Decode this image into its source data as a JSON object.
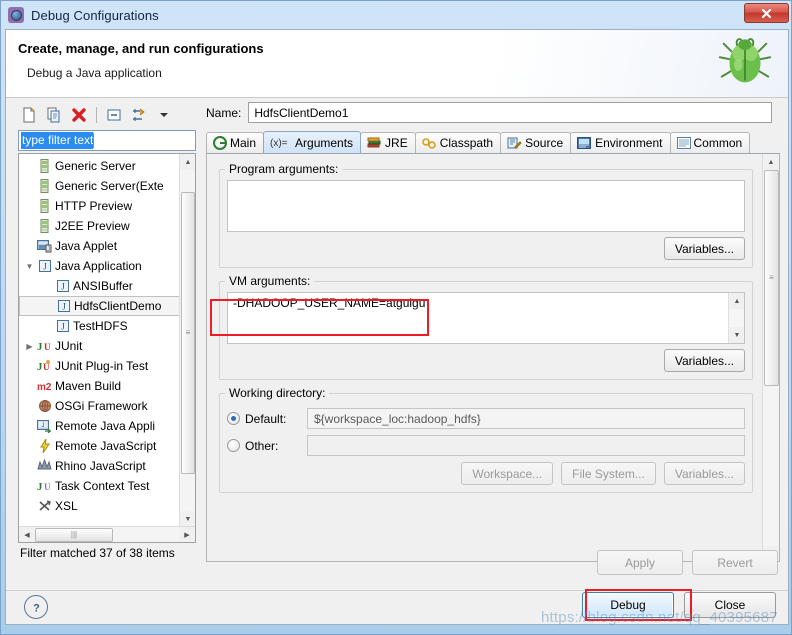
{
  "window": {
    "title": "Debug Configurations",
    "title_icon": "debug-config-icon",
    "close_label": "x"
  },
  "header": {
    "title": "Create, manage, and run configurations",
    "subtitle": "Debug a Java application",
    "icon": "green-bug-icon"
  },
  "tree_toolbar": {
    "items": [
      {
        "name": "new-launch-configuration",
        "icon": "new-document-icon"
      },
      {
        "name": "duplicate-configuration",
        "icon": "copy-icon"
      },
      {
        "name": "delete-configuration",
        "icon": "red-x-delete-icon"
      },
      {
        "name": "collapse-all",
        "icon": "collapse-all-icon"
      },
      {
        "name": "filter-configurations",
        "icon": "filter-arrows-icon"
      },
      {
        "name": "view-menu",
        "icon": "chevron-down-icon"
      }
    ]
  },
  "filter": {
    "value": "type filter text",
    "placeholder": "type filter text",
    "status": "Filter matched 37 of 38 items"
  },
  "tree": {
    "items": [
      {
        "label": "Generic Server",
        "icon": "server-icon",
        "indent": 1,
        "twisty": "",
        "selected": false
      },
      {
        "label": "Generic Server(Exte",
        "icon": "server-icon",
        "indent": 1,
        "twisty": "",
        "selected": false
      },
      {
        "label": "HTTP Preview",
        "icon": "server-icon",
        "indent": 1,
        "twisty": "",
        "selected": false
      },
      {
        "label": "J2EE Preview",
        "icon": "server-icon",
        "indent": 1,
        "twisty": "",
        "selected": false
      },
      {
        "label": "Java Applet",
        "icon": "java-applet-icon",
        "indent": 1,
        "twisty": "",
        "selected": false
      },
      {
        "label": "Java Application",
        "icon": "java-application-icon",
        "indent": 1,
        "twisty": "▼",
        "selected": false
      },
      {
        "label": "ANSIBuffer",
        "icon": "java-launch-icon",
        "indent": 2,
        "twisty": "",
        "selected": false
      },
      {
        "label": "HdfsClientDemo",
        "icon": "java-launch-icon",
        "indent": 2,
        "twisty": "",
        "selected": true
      },
      {
        "label": "TestHDFS",
        "icon": "java-launch-icon",
        "indent": 2,
        "twisty": "",
        "selected": false
      },
      {
        "label": "JUnit",
        "icon": "junit-icon",
        "indent": 1,
        "twisty": "▶",
        "selected": false
      },
      {
        "label": "JUnit Plug-in Test",
        "icon": "junit-plugin-icon",
        "indent": 1,
        "twisty": "",
        "selected": false
      },
      {
        "label": "Maven Build",
        "icon": "maven-m2-icon",
        "indent": 1,
        "twisty": "",
        "selected": false
      },
      {
        "label": "OSGi Framework",
        "icon": "osgi-icon",
        "indent": 1,
        "twisty": "",
        "selected": false
      },
      {
        "label": "Remote Java Appli",
        "icon": "remote-java-icon",
        "indent": 1,
        "twisty": "",
        "selected": false
      },
      {
        "label": "Remote JavaScript",
        "icon": "javascript-bolt-icon",
        "indent": 1,
        "twisty": "",
        "selected": false
      },
      {
        "label": "Rhino JavaScript",
        "icon": "rhino-icon",
        "indent": 1,
        "twisty": "",
        "selected": false
      },
      {
        "label": "Task Context Test",
        "icon": "task-context-icon",
        "indent": 1,
        "twisty": "",
        "selected": false
      },
      {
        "label": "XSL",
        "icon": "xsl-icon",
        "indent": 1,
        "twisty": "",
        "selected": false
      }
    ]
  },
  "config": {
    "name_label": "Name:",
    "name_value": "HdfsClientDemo1",
    "tabs": [
      {
        "label": "Main",
        "icon": "main-tab-icon",
        "active": false
      },
      {
        "label": "Arguments",
        "icon": "arguments-tab-icon",
        "active": true
      },
      {
        "label": "JRE",
        "icon": "jre-tab-icon",
        "active": false
      },
      {
        "label": "Classpath",
        "icon": "classpath-tab-icon",
        "active": false
      },
      {
        "label": "Source",
        "icon": "source-tab-icon",
        "active": false
      },
      {
        "label": "Environment",
        "icon": "environment-tab-icon",
        "active": false
      },
      {
        "label": "Common",
        "icon": "common-tab-icon",
        "active": false
      }
    ],
    "program_arguments": {
      "title": "Program arguments:",
      "value": "",
      "variables_label": "Variables..."
    },
    "vm_arguments": {
      "title": "VM arguments:",
      "value": "-DHADOOP_USER_NAME=atguigu",
      "variables_label": "Variables...",
      "highlight_color": "#ee1c24"
    },
    "working_directory": {
      "title": "Working directory:",
      "default_label": "Default:",
      "default_value": "${workspace_loc:hadoop_hdfs}",
      "default_selected": true,
      "other_label": "Other:",
      "other_value": "",
      "other_selected": false,
      "buttons": [
        {
          "label": "Workspace...",
          "disabled": true
        },
        {
          "label": "File System...",
          "disabled": true
        },
        {
          "label": "Variables...",
          "disabled": true
        }
      ]
    }
  },
  "footer": {
    "apply_label": "Apply",
    "apply_disabled": true,
    "revert_label": "Revert",
    "revert_disabled": true,
    "help_icon": "question-mark-help-icon",
    "debug_label": "Debug",
    "close_label": "Close"
  },
  "watermark": {
    "text": "https://blog.csdn.net/qq_40395687"
  }
}
